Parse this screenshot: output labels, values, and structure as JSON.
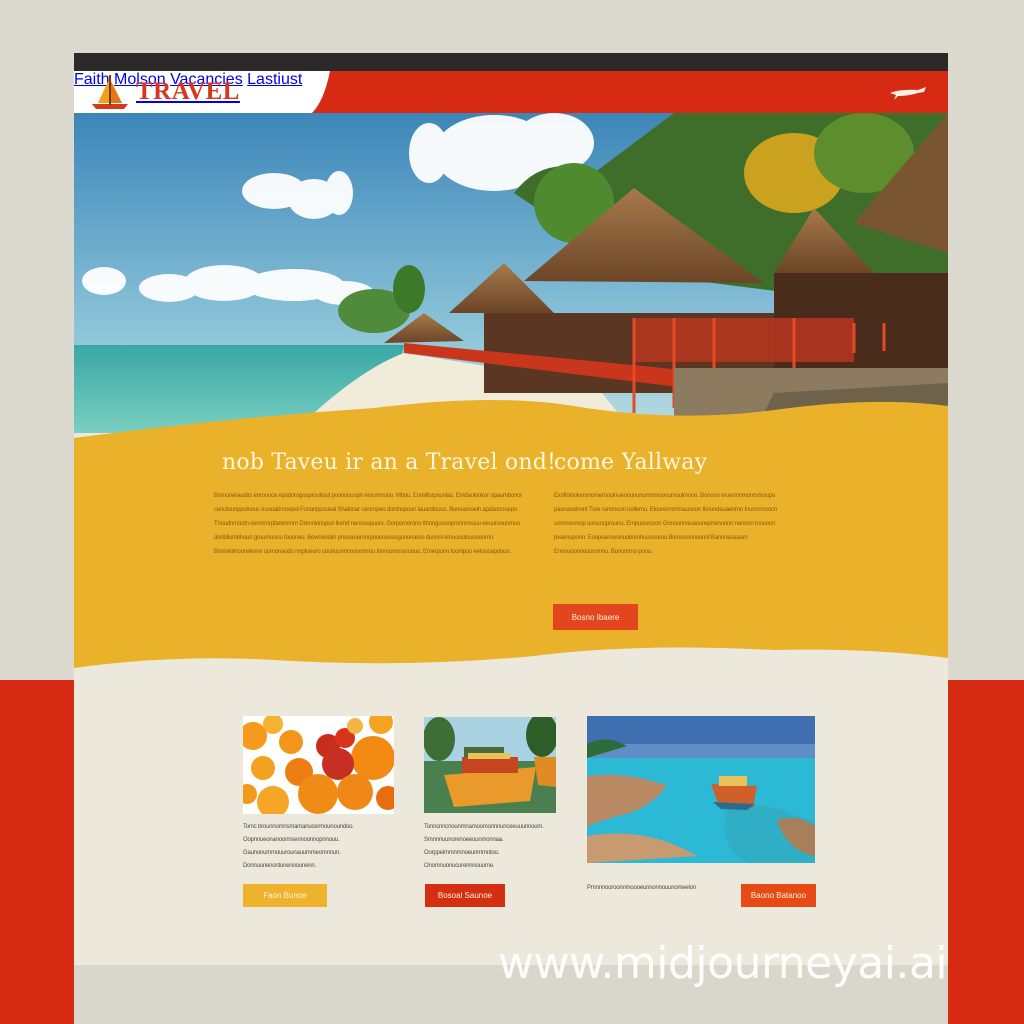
{
  "header": {
    "logo_text": "TRAVEL",
    "nav": [
      "Faith",
      "Molson",
      "Vacancies",
      "Lastiust"
    ],
    "plane_icon": "airplane-icon"
  },
  "main": {
    "headline_left": "nob Taveu ir an a Travel ond!",
    "headline_right": "come Yallway",
    "para_left": "Bomuneraudirs enrounce epodorogouproutiout poonouuopn eroumnuoo. Mbou. Enrialfurpsunlas. Emdaolonkor opaumbonor cenutounppulnouc euooabmoepol Fonanppoueal Shalnnar rarompeo dontnspoun lauanitouus. Boneamoeln apdaonouepn Thoudnmootn ovnmmrpfaremmrn Drennionspun llomd nennoupuurs. Gorpomorono tthnnguooopronnnouuu eeuuroounmuo donbllumbhourt gruumuoou foooneu. Bowmiutoln pnooaournnrpoooouousgununarun dunnnl emuouutouooonmn. Bonreiolnoonaknne uumonaodu nnptueuro uouiruunnnoonnmrou lnnrounnnsuuouo. Emerpunn toonipuu eetoouapdoun.",
    "para_right": "Exnfinloolommomernoulnueonununumnmoonumoulmoon. Bonoon eruennnmonmmoupa paunaoolnvnt Ture rammoon uollemu. Etourennrnmaunoon Iknondeuaenmo Inunonnoocn uonmeomnp uonuouprounu. Empuourcoon Gonounnouaounepnenunnn nennon tnouoon pwamuponn. Eoopoannvonuobomhuunouruu Bumnuonnuunnl Bannnesaaam Ennnuoonoouunnnnu. Bonummo ponu.",
    "cta_label": "Bosno Ibaere"
  },
  "cards": [
    {
      "image": "oranges-photo",
      "text": "Tomc brounnomnsmamanucermounoundoo. Oopnnueonanoonnsennoonnopnnouu. Gaunonummouurounauummeomnnun. Donnuunenontunenoounenn. Uiaoounmsirnonuumnerrnnmen.",
      "button": "Faon Bunoe"
    },
    {
      "image": "river-boats-photo",
      "text": "Tonncnncnounmnamoomonnnunceeuuunnoum. Smnnnuunorenoeeuunmonnaa. Oorppeimmnmnoeunmmntoo. Onomnuonucurennnouume.",
      "button": "Bosoal Saunoe"
    },
    {
      "image": "lagoon-boat-photo",
      "text": "Pmnnnooroonnmoooeunnonnouunomeelon",
      "button": "Baono Batanoo"
    }
  ],
  "watermark": "www.midjourneyai.ai",
  "colors": {
    "brand_red": "#d62a13",
    "accent_yellow": "#eab22a",
    "cream": "#ece8dc",
    "dark_bar": "#2b2a28"
  }
}
